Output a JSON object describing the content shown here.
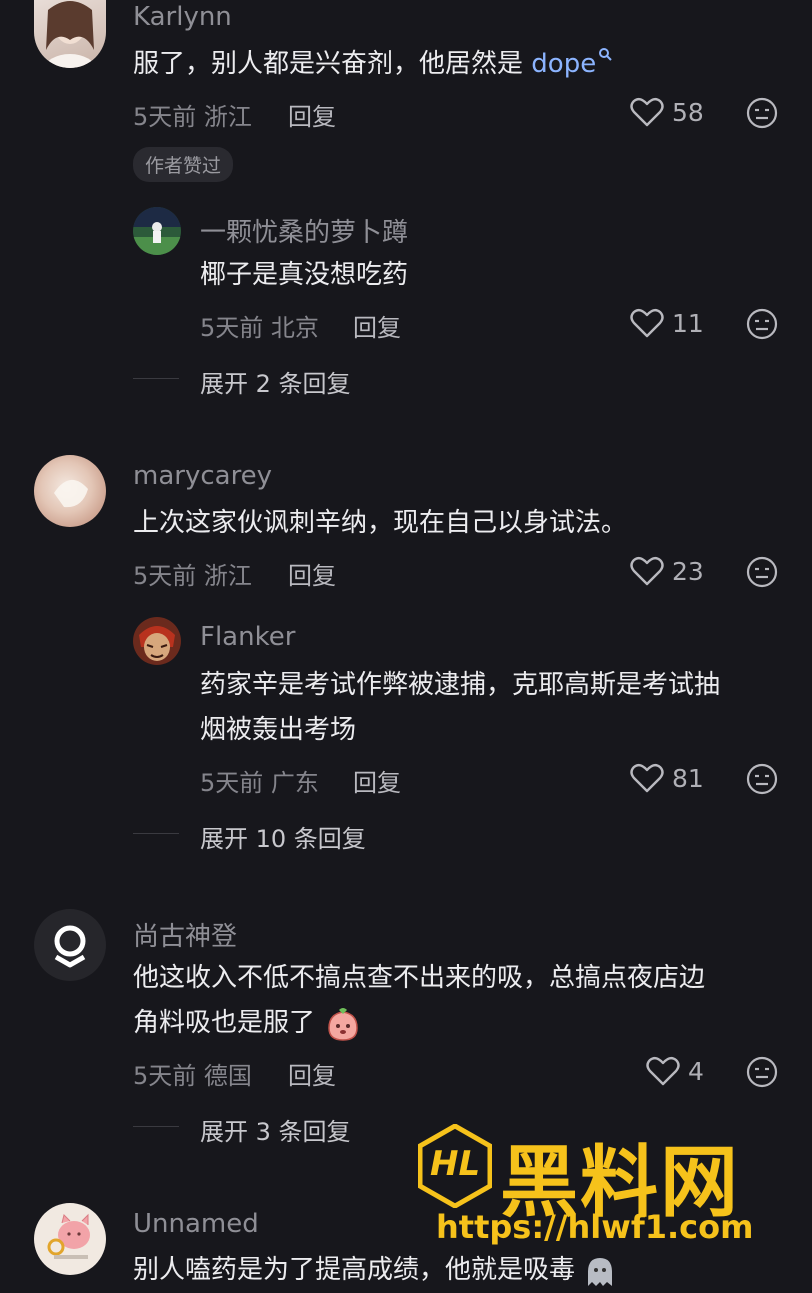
{
  "comments": [
    {
      "user": "Karlynn",
      "text": "服了，别人都是兴奋剂，他居然是",
      "link": "dope",
      "time": "5天前",
      "location": "浙江",
      "reply_label": "回复",
      "likes": "58",
      "badge": "作者赞过",
      "replies": [
        {
          "user": "一颗忧桑的萝卜蹲",
          "text": "椰子是真没想吃药",
          "time": "5天前",
          "location": "北京",
          "reply_label": "回复",
          "likes": "11"
        }
      ],
      "expand": "展开 2 条回复"
    },
    {
      "user": "marycarey",
      "text": "上次这家伙讽刺辛纳，现在自己以身试法。",
      "time": "5天前",
      "location": "浙江",
      "reply_label": "回复",
      "likes": "23",
      "replies": [
        {
          "user": "Flanker",
          "text_line1": "药家辛是考试作弊被逮捕，克耶高斯是考试抽",
          "text_line2": "烟被轰出考场",
          "time": "5天前",
          "location": "广东",
          "reply_label": "回复",
          "likes": "81"
        }
      ],
      "expand": "展开 10 条回复"
    },
    {
      "user": "尚古神登",
      "text_line1": "他这收入不低不搞点查不出来的吸，总搞点夜店边",
      "text_line2": "角料吸也是服了",
      "time": "5天前",
      "location": "德国",
      "reply_label": "回复",
      "likes": "4",
      "expand": "展开 3 条回复"
    },
    {
      "user": "Unnamed",
      "text": "别人嗑药是为了提高成绩，他就是吸毒"
    }
  ],
  "watermark": {
    "logo_text": "HL",
    "title": "黑料网",
    "url": "https://hlwf1.com"
  },
  "icons": {
    "like": "heart-outline-icon",
    "dislike": "meh-face-icon",
    "search": "search-icon"
  },
  "colors": {
    "background": "#17171c",
    "link": "#8cb4ff",
    "watermark": "#f6c21b"
  }
}
